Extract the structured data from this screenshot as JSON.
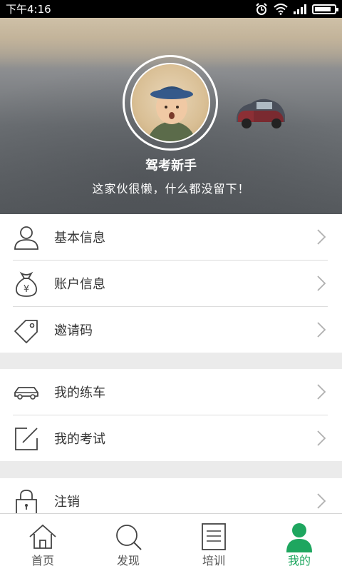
{
  "status_bar": {
    "time": "下午4:16"
  },
  "profile": {
    "nickname": "驾考新手",
    "signature": "这家伙很懒，什么都没留下！"
  },
  "menu_groups": [
    [
      {
        "icon": "user-icon",
        "label": "基本信息"
      },
      {
        "icon": "money-bag-icon",
        "label": "账户信息"
      },
      {
        "icon": "tag-icon",
        "label": "邀请码"
      }
    ],
    [
      {
        "icon": "car-icon",
        "label": "我的练车"
      },
      {
        "icon": "edit-icon",
        "label": "我的考试"
      }
    ],
    [
      {
        "icon": "lock-icon",
        "label": "注销"
      }
    ]
  ],
  "tabs": [
    {
      "icon": "home-icon",
      "label": "首页",
      "active": false
    },
    {
      "icon": "search-icon",
      "label": "发现",
      "active": false
    },
    {
      "icon": "document-icon",
      "label": "培训",
      "active": false
    },
    {
      "icon": "person-icon",
      "label": "我的",
      "active": true
    }
  ],
  "colors": {
    "accent": "#1ea65f",
    "icon_stroke": "#444444"
  }
}
